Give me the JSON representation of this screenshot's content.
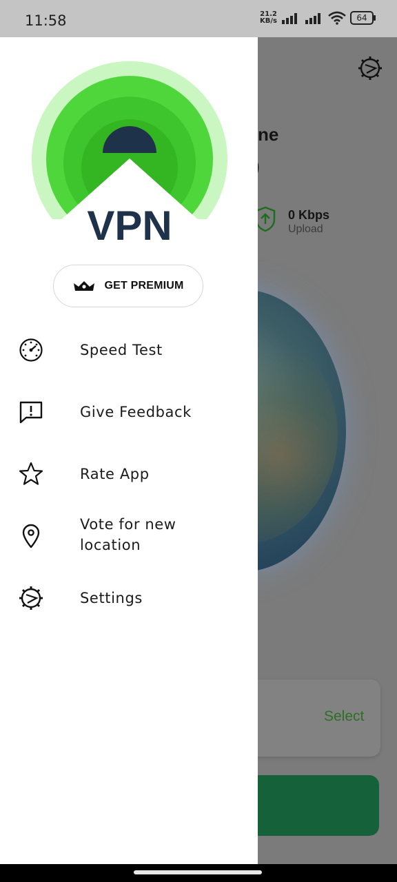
{
  "status_bar": {
    "time": "11:58",
    "net_speed_value": "21.2",
    "net_speed_unit": "KB/s",
    "battery": "64"
  },
  "background_app": {
    "title_line1": "ne",
    "title_line2": ")",
    "upload_value": "0 Kbps",
    "upload_label": "Upload",
    "select_label": "Select"
  },
  "drawer": {
    "logo_text": "VPN",
    "premium_label": "GET PREMIUM",
    "menu_items": [
      {
        "label": "Speed Test",
        "icon": "speedometer-icon"
      },
      {
        "label": "Give Feedback",
        "icon": "feedback-icon"
      },
      {
        "label": "Rate App",
        "icon": "star-icon"
      },
      {
        "label": "Vote for new location",
        "icon": "location-pin-icon"
      },
      {
        "label": "Settings",
        "icon": "gear-icon"
      }
    ]
  },
  "colors": {
    "brand_green": "#3fcf2a",
    "light_green": "#c7f5c0",
    "navy": "#1e3349",
    "select_green": "#2e6f24",
    "button_green": "#15613a"
  }
}
